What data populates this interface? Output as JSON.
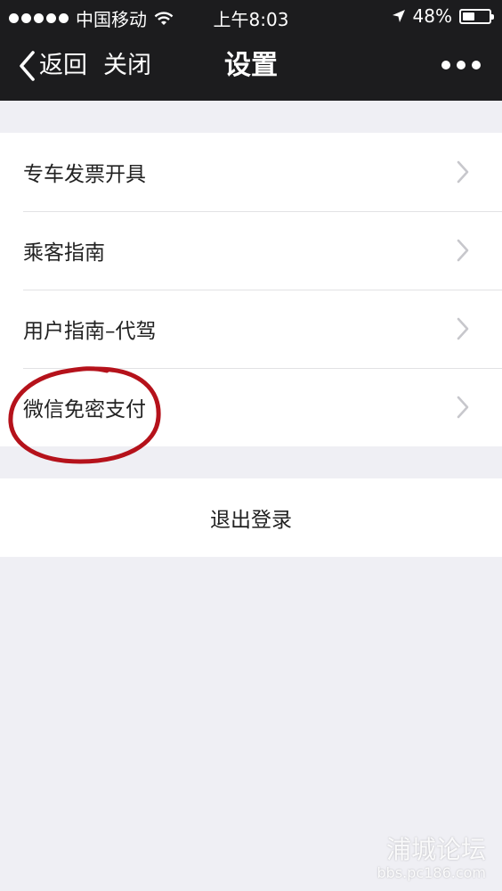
{
  "status_bar": {
    "carrier": "中国移动",
    "time": "上午8:03",
    "battery_percent": "48%",
    "battery_level": 0.48,
    "icons": [
      "signal-dots-icon",
      "wifi-icon",
      "location-arrow-icon",
      "battery-icon"
    ]
  },
  "nav": {
    "back_label": "返回",
    "close_label": "关闭",
    "title": "设置",
    "more_icon": "more-dots-icon"
  },
  "menu": {
    "items": [
      {
        "label": "专车发票开具"
      },
      {
        "label": "乘客指南"
      },
      {
        "label": "用户指南–代驾"
      },
      {
        "label": "微信免密支付"
      }
    ]
  },
  "logout": {
    "label": "退出登录"
  },
  "annotation": {
    "color": "#b5121b",
    "target": "微信免密支付"
  },
  "watermark": {
    "title": "浦城论坛",
    "url": "bbs.pc186.com"
  },
  "colors": {
    "nav_background": "#1c1c1e",
    "page_background": "#efeff4",
    "chevron": "#c7c7cc"
  }
}
